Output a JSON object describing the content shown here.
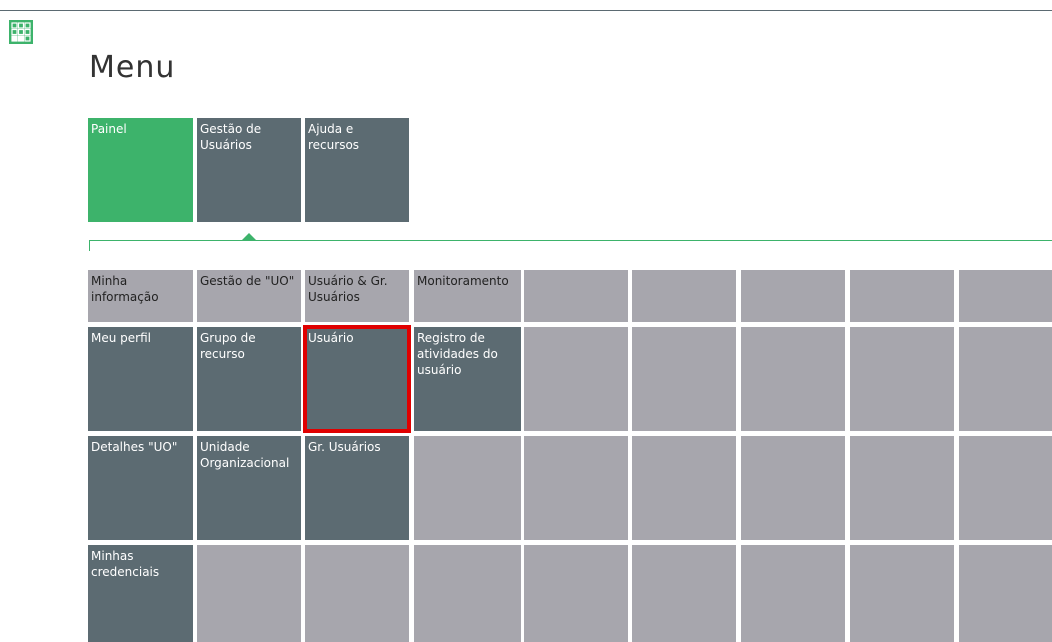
{
  "page": {
    "title": "Menu"
  },
  "colors": {
    "active_tab": "#3db36b",
    "tile_dark": "#5c6b72",
    "tile_light": "#a7a6ad",
    "selection": "#e00000"
  },
  "top_tabs": [
    {
      "label": "Painel",
      "active": true
    },
    {
      "label": "Gestão de Usuários",
      "active": false
    },
    {
      "label": "Ajuda e recursos",
      "active": false
    }
  ],
  "columns": [
    {
      "header": "Minha informação",
      "items": [
        "Meu perfil",
        "Detalhes \"UO\"",
        "Minhas credenciais"
      ]
    },
    {
      "header": "Gestão de \"UO\"",
      "items": [
        "Grupo de recurso",
        "Unidade Organizacional"
      ]
    },
    {
      "header": "Usuário & Gr. Usuários",
      "items": [
        "Usuário",
        "Gr. Usuários"
      ]
    },
    {
      "header": "Monitoramento",
      "items": [
        "Registro de atividades do usuário"
      ]
    }
  ],
  "selected_item": "Usuário"
}
